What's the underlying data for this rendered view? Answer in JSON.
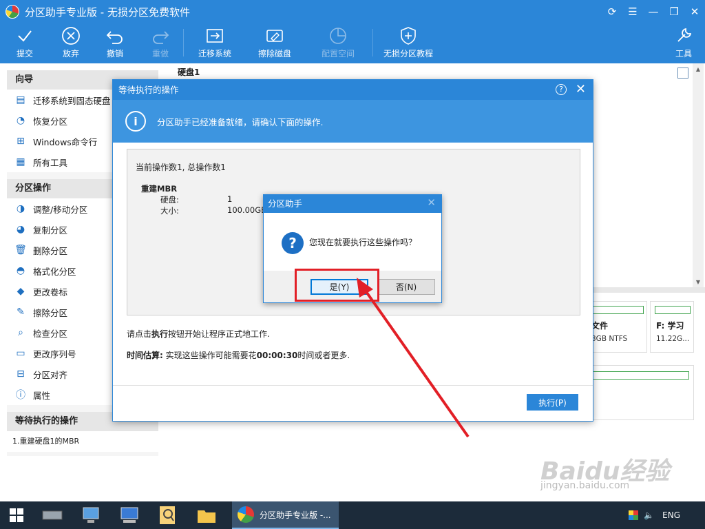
{
  "window": {
    "title": "分区助手专业版 - 无损分区免费软件"
  },
  "toolbar": {
    "items": [
      {
        "label": "提交",
        "icon": "checkmark-icon"
      },
      {
        "label": "放弃",
        "icon": "discard-icon"
      },
      {
        "label": "撤销",
        "icon": "undo-icon"
      },
      {
        "label": "重做",
        "icon": "redo-icon"
      },
      {
        "label": "迁移系统",
        "icon": "migrate-os-icon"
      },
      {
        "label": "擦除磁盘",
        "icon": "wipe-disk-icon"
      },
      {
        "label": "配置空间",
        "icon": "allocate-space-icon"
      },
      {
        "label": "无损分区教程",
        "icon": "shield-icon"
      },
      {
        "label": "工具",
        "icon": "tools-icon"
      }
    ]
  },
  "sidebar": {
    "wizard_title": "向导",
    "wizard_items": [
      {
        "label": "迁移系统到固态硬盘",
        "icon": "migrate-ssd-icon"
      },
      {
        "label": "恢复分区",
        "icon": "recover-icon"
      },
      {
        "label": "Windows命令行",
        "icon": "windows-icon"
      },
      {
        "label": "所有工具",
        "icon": "all-tools-icon"
      }
    ],
    "ops_title": "分区操作",
    "ops_items": [
      {
        "label": "调整/移动分区",
        "icon": "resize-icon"
      },
      {
        "label": "复制分区",
        "icon": "copy-icon"
      },
      {
        "label": "删除分区",
        "icon": "delete-icon"
      },
      {
        "label": "格式化分区",
        "icon": "format-icon"
      },
      {
        "label": "更改卷标",
        "icon": "label-icon"
      },
      {
        "label": "擦除分区",
        "icon": "wipe-icon"
      },
      {
        "label": "检查分区",
        "icon": "check-icon"
      },
      {
        "label": "更改序列号",
        "icon": "serial-icon"
      },
      {
        "label": "分区对齐",
        "icon": "align-icon"
      },
      {
        "label": "属性",
        "icon": "info-icon"
      }
    ],
    "pending_title": "等待执行的操作",
    "pending_items": [
      "1.重建硬盘1的MBR"
    ]
  },
  "disk": {
    "header": "硬盘1",
    "part1_name": "文件",
    "part1_info": "3GB NTFS",
    "part2_name": "F: 学习",
    "part2_info": "11.22G..."
  },
  "pending_dialog": {
    "title": "等待执行的操作",
    "banner": "分区助手已经准备就绪，请确认下面的操作.",
    "op_count": "当前操作数1, 总操作数1",
    "op_title": "重建MBR",
    "op_disk_label": "硬盘:",
    "op_disk_value": "1",
    "op_size_label": "大小:",
    "op_size_value": "100.00GB",
    "hint_pre": "请点击",
    "hint_bold": "执行",
    "hint_post": "按钮开始让程序正式地工作.",
    "time_label": "时间估算:",
    "time_pre": " 实现这些操作可能需要花",
    "time_value": "00:00:30",
    "time_post": "时间或者更多.",
    "execute_button": "执行(P)"
  },
  "confirm_dialog": {
    "title": "分区助手",
    "message": "您现在就要执行这些操作吗？",
    "yes_button": "是(Y)",
    "no_button": "否(N)"
  },
  "taskbar": {
    "active_app": "分区助手专业版 -...",
    "lang": "ENG"
  },
  "watermark": {
    "logo": "Baidu经验",
    "url": "jingyan.baidu.com"
  },
  "colors": {
    "accent": "#2b86d8",
    "highlight": "#e21f26"
  }
}
